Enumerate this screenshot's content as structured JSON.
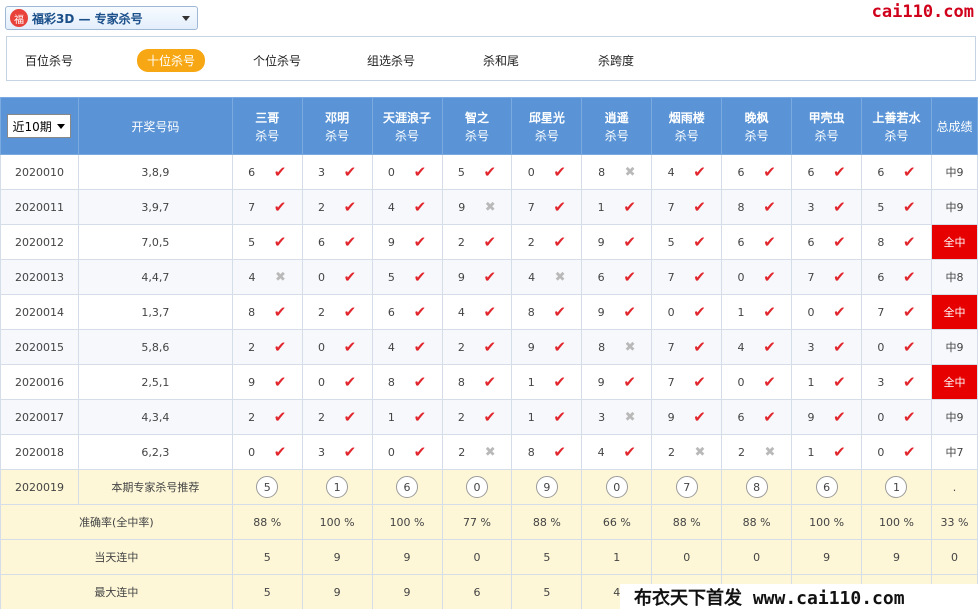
{
  "header": {
    "logo_glyph": "福",
    "lottery_label": "福彩3D — 专家杀号",
    "site": "cai110.com"
  },
  "tabs": [
    "百位杀号",
    "十位杀号",
    "个位杀号",
    "组选杀号",
    "杀和尾",
    "杀跨度"
  ],
  "active_tab": 1,
  "table": {
    "period_select": "近10期",
    "draw_header": "开奖号码",
    "experts": [
      "三哥",
      "邓明",
      "天涯浪子",
      "智之",
      "邱星光",
      "逍遥",
      "烟雨楼",
      "晚枫",
      "甲壳虫",
      "上善若水"
    ],
    "sub_label": "杀号",
    "result_header": "总成绩",
    "rows": [
      {
        "period": "2020010",
        "draw": "3,8,9",
        "kills": [
          "6",
          "3",
          "0",
          "5",
          "0",
          "8",
          "4",
          "6",
          "6",
          "6"
        ],
        "ok": [
          1,
          1,
          1,
          1,
          1,
          0,
          1,
          1,
          1,
          1
        ],
        "result": "中9",
        "full": false
      },
      {
        "period": "2020011",
        "draw": "3,9,7",
        "kills": [
          "7",
          "2",
          "4",
          "9",
          "7",
          "1",
          "7",
          "8",
          "3",
          "5"
        ],
        "ok": [
          1,
          1,
          1,
          0,
          1,
          1,
          1,
          1,
          1,
          1
        ],
        "result": "中9",
        "full": false
      },
      {
        "period": "2020012",
        "draw": "7,0,5",
        "kills": [
          "5",
          "6",
          "9",
          "2",
          "2",
          "9",
          "5",
          "6",
          "6",
          "8"
        ],
        "ok": [
          1,
          1,
          1,
          1,
          1,
          1,
          1,
          1,
          1,
          1
        ],
        "result": "全中",
        "full": true
      },
      {
        "period": "2020013",
        "draw": "4,4,7",
        "kills": [
          "4",
          "0",
          "5",
          "9",
          "4",
          "6",
          "7",
          "0",
          "7",
          "6"
        ],
        "ok": [
          0,
          1,
          1,
          1,
          0,
          1,
          1,
          1,
          1,
          1
        ],
        "result": "中8",
        "full": false
      },
      {
        "period": "2020014",
        "draw": "1,3,7",
        "kills": [
          "8",
          "2",
          "6",
          "4",
          "8",
          "9",
          "0",
          "1",
          "0",
          "7"
        ],
        "ok": [
          1,
          1,
          1,
          1,
          1,
          1,
          1,
          1,
          1,
          1
        ],
        "result": "全中",
        "full": true
      },
      {
        "period": "2020015",
        "draw": "5,8,6",
        "kills": [
          "2",
          "0",
          "4",
          "2",
          "9",
          "8",
          "7",
          "4",
          "3",
          "0"
        ],
        "ok": [
          1,
          1,
          1,
          1,
          1,
          0,
          1,
          1,
          1,
          1
        ],
        "result": "中9",
        "full": false
      },
      {
        "period": "2020016",
        "draw": "2,5,1",
        "kills": [
          "9",
          "0",
          "8",
          "8",
          "1",
          "9",
          "7",
          "0",
          "1",
          "3"
        ],
        "ok": [
          1,
          1,
          1,
          1,
          1,
          1,
          1,
          1,
          1,
          1
        ],
        "result": "全中",
        "full": true
      },
      {
        "period": "2020017",
        "draw": "4,3,4",
        "kills": [
          "2",
          "2",
          "1",
          "2",
          "1",
          "3",
          "9",
          "6",
          "9",
          "0"
        ],
        "ok": [
          1,
          1,
          1,
          1,
          1,
          0,
          1,
          1,
          1,
          1
        ],
        "result": "中9",
        "full": false
      },
      {
        "period": "2020018",
        "draw": "6,2,3",
        "kills": [
          "0",
          "3",
          "0",
          "2",
          "8",
          "4",
          "2",
          "2",
          "1",
          "0"
        ],
        "ok": [
          1,
          1,
          1,
          0,
          1,
          1,
          0,
          0,
          1,
          1
        ],
        "result": "中7",
        "full": false
      }
    ],
    "recommend": {
      "period": "2020019",
      "label": "本期专家杀号推荐",
      "nums": [
        "5",
        "1",
        "6",
        "0",
        "9",
        "0",
        "7",
        "8",
        "6",
        "1"
      ],
      "result": "."
    },
    "stats": [
      {
        "label": "准确率(全中率)",
        "vals": [
          "88 %",
          "100 %",
          "100 %",
          "77 %",
          "88 %",
          "66 %",
          "88 %",
          "88 %",
          "100 %",
          "100 %"
        ],
        "result": "33 %"
      },
      {
        "label": "当天连中",
        "vals": [
          "5",
          "9",
          "9",
          "0",
          "5",
          "1",
          "0",
          "0",
          "9",
          "9"
        ],
        "result": "0"
      },
      {
        "label": "最大连中",
        "vals": [
          "5",
          "9",
          "9",
          "6",
          "5",
          "4",
          "",
          "",
          "",
          ""
        ],
        "result": ""
      }
    ]
  },
  "marks": {
    "ok": "✔",
    "no": "✖"
  },
  "watermark": "布衣天下首发 www.cai110.com"
}
